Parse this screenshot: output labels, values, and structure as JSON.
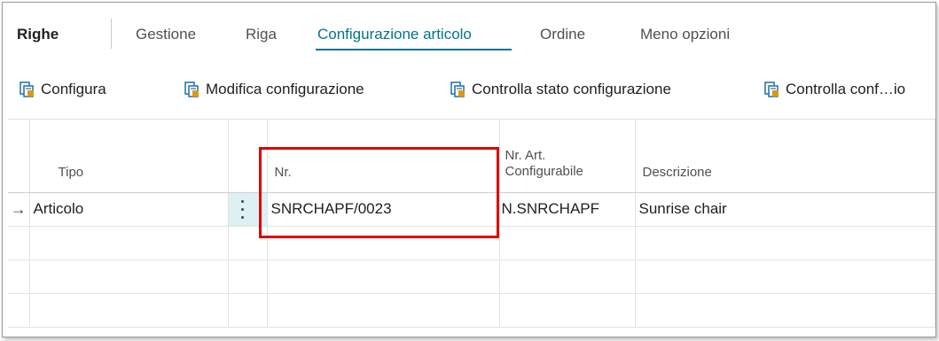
{
  "menu": {
    "title": "Righe",
    "items": [
      {
        "label": "Gestione"
      },
      {
        "label": "Riga"
      },
      {
        "label": "Configurazione articolo"
      },
      {
        "label": "Ordine"
      },
      {
        "label": "Meno opzioni"
      }
    ]
  },
  "actions": [
    {
      "label": "Configura",
      "icon": "config-doc-icon"
    },
    {
      "label": "Modifica configurazione",
      "icon": "config-doc-icon"
    },
    {
      "label": "Controlla stato configurazione",
      "icon": "config-doc-icon"
    },
    {
      "label": "Controlla conf…io",
      "icon": "config-doc-icon"
    }
  ],
  "table": {
    "headers": {
      "tipo": "Tipo",
      "nr": "Nr.",
      "conf_line1": "Nr. Art.",
      "conf_line2": "Configurabile",
      "desc": "Descrizione"
    },
    "rows": [
      {
        "tipo": "Articolo",
        "nr": "SNRCHAPF/0023",
        "conf": "N.SNRCHAPF",
        "desc": "Sunrise chair"
      }
    ],
    "row_indicator": "→"
  },
  "colors": {
    "accent": "#00758f",
    "highlight": "#e00000",
    "selected_cell": "#ddf0f3"
  }
}
